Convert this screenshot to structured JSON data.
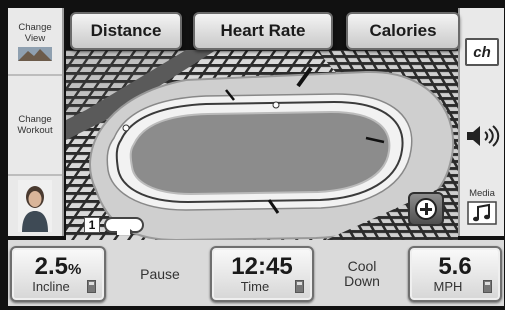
{
  "tabs": {
    "distance": "Distance",
    "heart_rate": "Heart Rate",
    "calories": "Calories"
  },
  "left_panel": {
    "change_view": "Change View",
    "change_workout": "Change Workout"
  },
  "right_panel": {
    "channel_icon_text": "ch",
    "media_label": "Media"
  },
  "track": {
    "lap_number": "1",
    "zoom_icon": "plus-icon"
  },
  "bottom_bar": {
    "incline_value": "2.5",
    "incline_unit": "%",
    "incline_label": "Incline",
    "pause_label": "Pause",
    "time_value": "12:45",
    "time_label": "Time",
    "cool_down_label": "Cool Down",
    "speed_value": "5.6",
    "speed_label": "MPH"
  },
  "icons": {
    "change_view": "mountain-thumbnail-icon",
    "change_workout": "person-avatar-icon",
    "volume": "speaker-volume-icon",
    "media": "music-note-icon",
    "calculator": "calculator-icon",
    "lap": "lap-loop-icon"
  },
  "colors": {
    "panel": "#e9e9e9",
    "bezel": "#111111",
    "track_infield": "#8a8a8a"
  }
}
